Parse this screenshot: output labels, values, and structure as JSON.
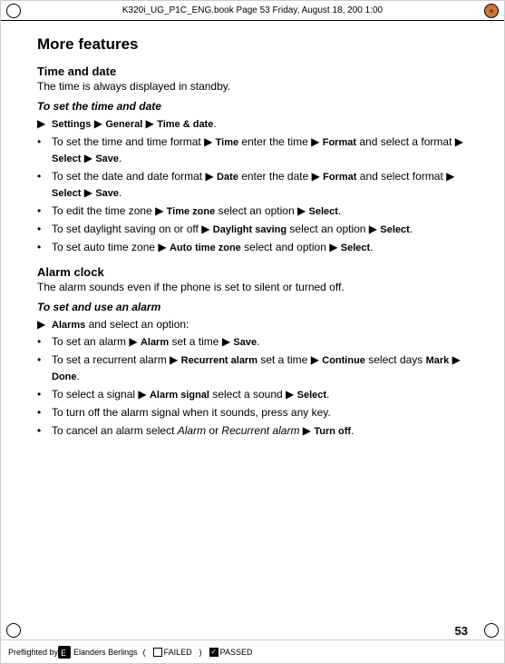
{
  "header": {
    "book_info": "K320i_UG_P1C_ENG.book  Page 53  Friday, August 18, 200   1:00 "
  },
  "page": {
    "number": "53",
    "title": "More features",
    "sections": [
      {
        "id": "time-date",
        "title": "Time and date",
        "description": "The time is always displayed in standby.",
        "subsections": [
          {
            "id": "set-time-date",
            "title": "To set the time and date",
            "bullets": [
              {
                "type": "arrow",
                "text_plain": " Settings ",
                "text_bold": "",
                "full": "▶ Settings ▶ General ▶ Time & date."
              },
              {
                "type": "bullet",
                "full": "To set the time and time format ▶ Time enter the time ▶ Format and select a format ▶ Select ▶ Save."
              },
              {
                "type": "bullet",
                "full": "To set the date and date format ▶ Date enter the date ▶ Format and select format ▶ Select ▶ Save."
              },
              {
                "type": "bullet",
                "full": "To edit the time zone ▶ Time zone select an option ▶ Select."
              },
              {
                "type": "bullet",
                "full": "To set daylight saving on or off ▶ Daylight saving select an option ▶ Select."
              },
              {
                "type": "bullet",
                "full": "To set auto time zone ▶ Auto time zone select and option ▶ Select."
              }
            ]
          }
        ]
      },
      {
        "id": "alarm-clock",
        "title": "Alarm clock",
        "description": "The alarm sounds even if the phone is set to silent or turned off.",
        "subsections": [
          {
            "id": "set-use-alarm",
            "title": "To set and use an alarm",
            "bullets": [
              {
                "type": "arrow",
                "full": "▶ Alarms and select an option:"
              },
              {
                "type": "bullet",
                "full": "To set an alarm ▶ Alarm set a time ▶ Save."
              },
              {
                "type": "bullet",
                "full": "To set a recurrent alarm ▶ Recurrent alarm set a time ▶ Continue select days Mark ▶ Done."
              },
              {
                "type": "bullet",
                "full": "To select a signal ▶ Alarm signal select a sound ▶ Select."
              },
              {
                "type": "bullet",
                "full": "To turn off the alarm signal when it sounds, press any key."
              },
              {
                "type": "bullet",
                "full": "To cancel an alarm select Alarm or Recurrent alarm ▶ Turn off."
              }
            ]
          }
        ]
      }
    ]
  },
  "bottom": {
    "preflighted_label": "Preflighted by",
    "company": "Elanders Berlings",
    "failed_label": "FAILED",
    "passed_label": "PASSED"
  }
}
